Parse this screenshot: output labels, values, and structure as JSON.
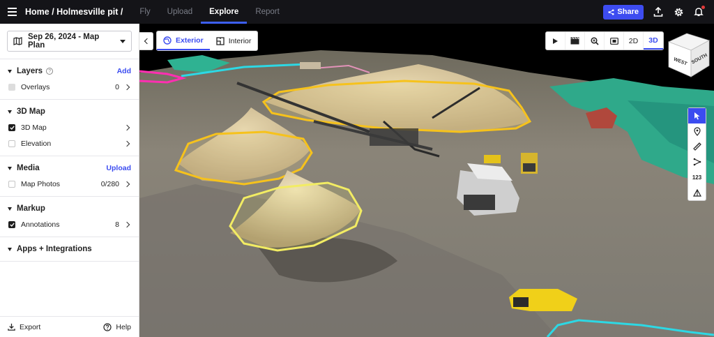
{
  "header": {
    "breadcrumb": "Home / Holmesville pit /",
    "tabs": [
      "Fly",
      "Upload",
      "Explore",
      "Report"
    ],
    "active_tab": "Explore",
    "share_label": "Share"
  },
  "sidebar": {
    "date_select": "Sep 26, 2024 - Map Plan",
    "sections": [
      {
        "title": "Layers",
        "action": "Add",
        "rows": [
          {
            "label": "Overlays",
            "count": "0",
            "checked": false
          }
        ]
      },
      {
        "title": "3D Map",
        "rows": [
          {
            "label": "3D Map",
            "checked": true
          },
          {
            "label": "Elevation",
            "checked": false
          }
        ]
      },
      {
        "title": "Media",
        "action": "Upload",
        "rows": [
          {
            "label": "Map Photos",
            "count": "0/280",
            "checked": false
          }
        ]
      },
      {
        "title": "Markup",
        "rows": [
          {
            "label": "Annotations",
            "count": "8",
            "checked": true
          }
        ]
      },
      {
        "title": "Apps + Integrations"
      }
    ],
    "footer": {
      "export_label": "Export",
      "help_label": "Help"
    }
  },
  "viewport": {
    "mode_tabs": [
      "Exterior",
      "Interior"
    ],
    "active_mode": "Exterior",
    "view_tools": [
      "2D",
      "3D"
    ],
    "active_view": "3D",
    "cube_labels": [
      "WEST",
      "SOUTH"
    ],
    "measure_label": "123"
  },
  "colors": {
    "accent": "#3d4cf0",
    "topbar": "#141418",
    "annotation_yellow": "#f6c21c",
    "annotation_pale_yellow": "#f2ec63",
    "annotation_cyan": "#2dd8e4",
    "annotation_pink": "#ff2fb1"
  }
}
